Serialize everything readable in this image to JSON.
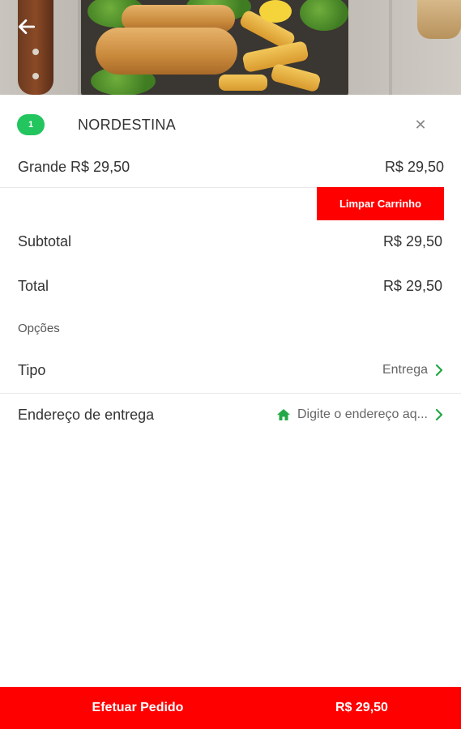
{
  "header": {
    "back_icon": "arrow-left-icon"
  },
  "cart": {
    "badge_count": "1",
    "shop_name": "NORDESTINA",
    "close_icon": "close-icon",
    "item": {
      "name": "Grande R$ 29,50",
      "price": "R$ 29,50"
    },
    "clear_label": "Limpar Carrinho"
  },
  "summary": {
    "subtotal_label": "Subtotal",
    "subtotal_value": "R$ 29,50",
    "total_label": "Total",
    "total_value": "R$ 29,50"
  },
  "options": {
    "title": "Opções",
    "type_label": "Tipo",
    "type_value": "Entrega",
    "address_label": "Endereço de entrega",
    "address_placeholder": "Digite o endereço aq...",
    "address_icon": "home-icon"
  },
  "footer": {
    "checkout_label": "Efetuar Pedido",
    "checkout_price": "R$ 29,50"
  },
  "colors": {
    "accent_red": "#ff0000",
    "badge_green": "#22c55e",
    "icon_green": "#22a846"
  }
}
